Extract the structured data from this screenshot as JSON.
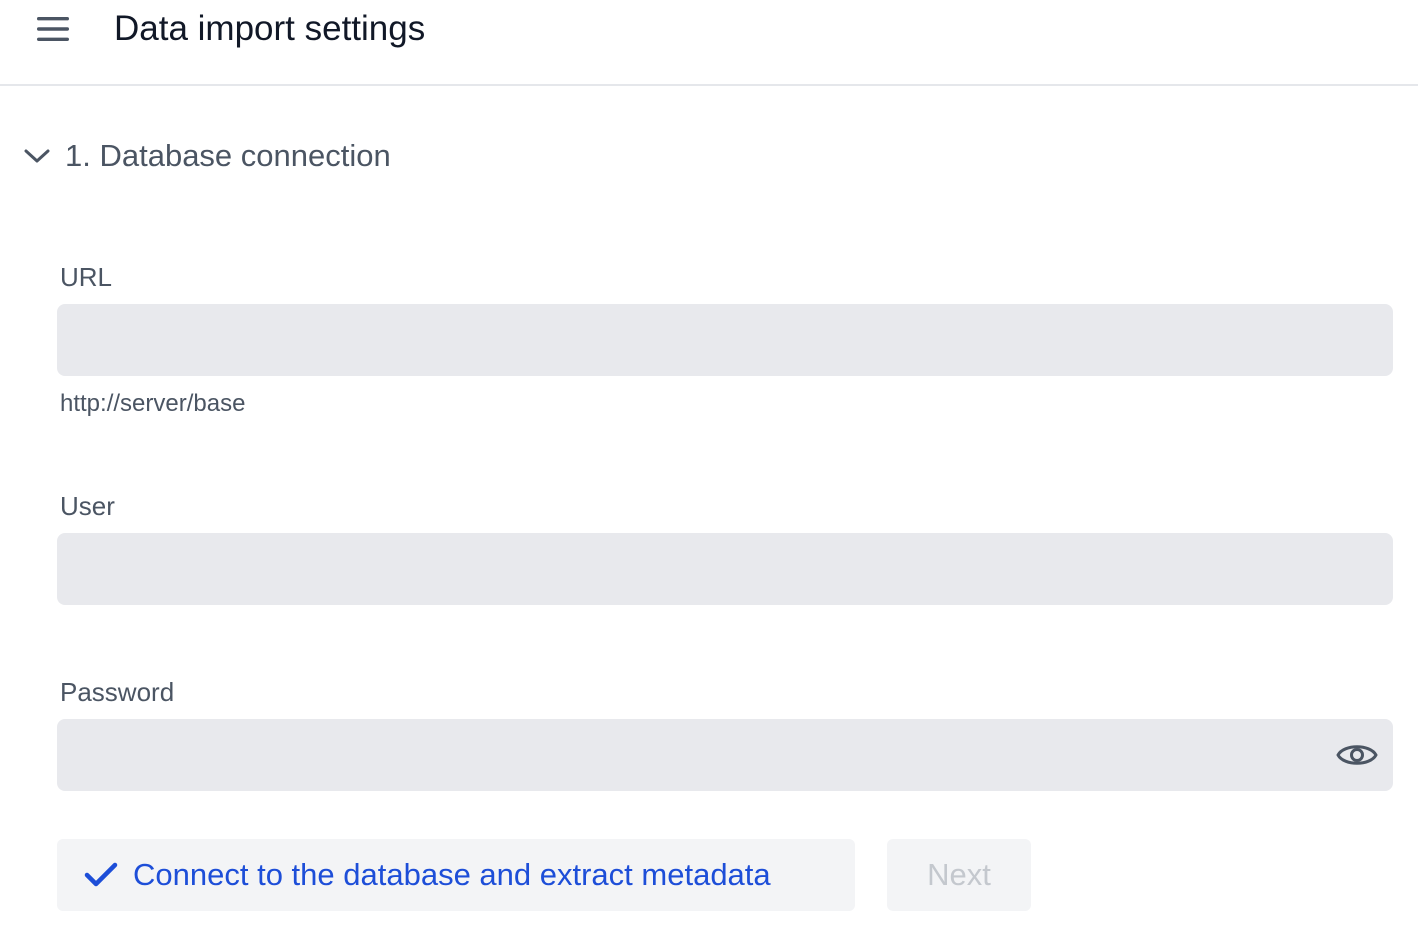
{
  "header": {
    "menu_icon": "hamburger-menu-icon",
    "title": "Data import settings"
  },
  "section": {
    "expand_icon": "chevron-down-icon",
    "title": "1. Database connection",
    "expanded": true
  },
  "form": {
    "url": {
      "label": "URL",
      "value": "",
      "hint": "http://server/base"
    },
    "user": {
      "label": "User",
      "value": ""
    },
    "password": {
      "label": "Password",
      "value": "",
      "toggle_icon": "eye-icon"
    }
  },
  "actions": {
    "connect": {
      "icon": "checkmark-icon",
      "label": "Connect to the database and extract metadata"
    },
    "next": {
      "label": "Next",
      "disabled": true
    }
  },
  "colors": {
    "accent": "#1d4ed8",
    "input_background": "#e8e9ed",
    "button_background": "#f3f4f6",
    "disabled_text": "#c4c8ce"
  }
}
